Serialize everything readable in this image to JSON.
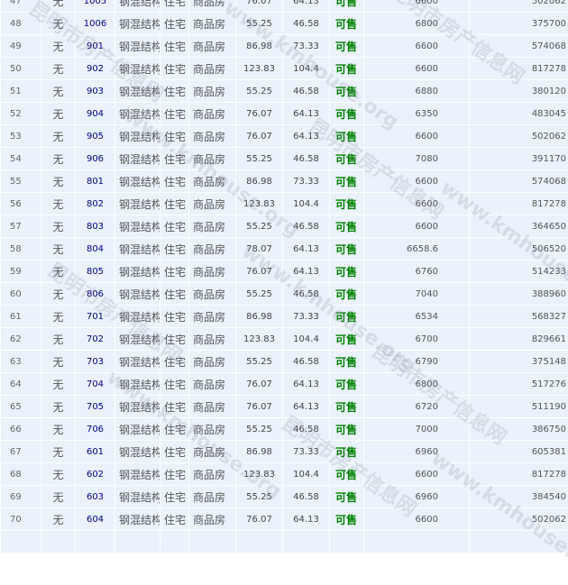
{
  "rows": [
    {
      "idx": "47",
      "wu": "无",
      "room": "1005",
      "struct": "钢混结构",
      "use": "住宅",
      "type": "商品房",
      "area": "76.07",
      "inner": "64.13",
      "status": "可售",
      "price": "6600",
      "total": "502062"
    },
    {
      "idx": "48",
      "wu": "无",
      "room": "1006",
      "struct": "钢混结构",
      "use": "住宅",
      "type": "商品房",
      "area": "55.25",
      "inner": "46.58",
      "status": "可售",
      "price": "6800",
      "total": "375700"
    },
    {
      "idx": "49",
      "wu": "无",
      "room": "901",
      "struct": "钢混结构",
      "use": "住宅",
      "type": "商品房",
      "area": "86.98",
      "inner": "73.33",
      "status": "可售",
      "price": "6600",
      "total": "574068"
    },
    {
      "idx": "50",
      "wu": "无",
      "room": "902",
      "struct": "钢混结构",
      "use": "住宅",
      "type": "商品房",
      "area": "123.83",
      "inner": "104.4",
      "status": "可售",
      "price": "6600",
      "total": "817278"
    },
    {
      "idx": "51",
      "wu": "无",
      "room": "903",
      "struct": "钢混结构",
      "use": "住宅",
      "type": "商品房",
      "area": "55.25",
      "inner": "46.58",
      "status": "可售",
      "price": "6880",
      "total": "380120"
    },
    {
      "idx": "52",
      "wu": "无",
      "room": "904",
      "struct": "钢混结构",
      "use": "住宅",
      "type": "商品房",
      "area": "76.07",
      "inner": "64.13",
      "status": "可售",
      "price": "6350",
      "total": "483045"
    },
    {
      "idx": "53",
      "wu": "无",
      "room": "905",
      "struct": "钢混结构",
      "use": "住宅",
      "type": "商品房",
      "area": "76.07",
      "inner": "64.13",
      "status": "可售",
      "price": "6600",
      "total": "502062"
    },
    {
      "idx": "54",
      "wu": "无",
      "room": "906",
      "struct": "钢混结构",
      "use": "住宅",
      "type": "商品房",
      "area": "55.25",
      "inner": "46.58",
      "status": "可售",
      "price": "7080",
      "total": "391170"
    },
    {
      "idx": "55",
      "wu": "无",
      "room": "801",
      "struct": "钢混结构",
      "use": "住宅",
      "type": "商品房",
      "area": "86.98",
      "inner": "73.33",
      "status": "可售",
      "price": "6600",
      "total": "574068"
    },
    {
      "idx": "56",
      "wu": "无",
      "room": "802",
      "struct": "钢混结构",
      "use": "住宅",
      "type": "商品房",
      "area": "123.83",
      "inner": "104.4",
      "status": "可售",
      "price": "6600",
      "total": "817278"
    },
    {
      "idx": "57",
      "wu": "无",
      "room": "803",
      "struct": "钢混结构",
      "use": "住宅",
      "type": "商品房",
      "area": "55.25",
      "inner": "46.58",
      "status": "可售",
      "price": "6600",
      "total": "364650"
    },
    {
      "idx": "58",
      "wu": "无",
      "room": "804",
      "struct": "钢混结构",
      "use": "住宅",
      "type": "商品房",
      "area": "78.07",
      "inner": "64.13",
      "status": "可售",
      "price": "6658.6",
      "total": "506520"
    },
    {
      "idx": "59",
      "wu": "无",
      "room": "805",
      "struct": "钢混结构",
      "use": "住宅",
      "type": "商品房",
      "area": "76.07",
      "inner": "64.13",
      "status": "可售",
      "price": "6760",
      "total": "514233"
    },
    {
      "idx": "60",
      "wu": "无",
      "room": "806",
      "struct": "钢混结构",
      "use": "住宅",
      "type": "商品房",
      "area": "55.25",
      "inner": "46.58",
      "status": "可售",
      "price": "7040",
      "total": "388960"
    },
    {
      "idx": "61",
      "wu": "无",
      "room": "701",
      "struct": "钢混结构",
      "use": "住宅",
      "type": "商品房",
      "area": "86.98",
      "inner": "73.33",
      "status": "可售",
      "price": "6534",
      "total": "568327"
    },
    {
      "idx": "62",
      "wu": "无",
      "room": "702",
      "struct": "钢混结构",
      "use": "住宅",
      "type": "商品房",
      "area": "123.83",
      "inner": "104.4",
      "status": "可售",
      "price": "6700",
      "total": "829661"
    },
    {
      "idx": "63",
      "wu": "无",
      "room": "703",
      "struct": "钢混结构",
      "use": "住宅",
      "type": "商品房",
      "area": "55.25",
      "inner": "46.58",
      "status": "可售",
      "price": "6790",
      "total": "375148"
    },
    {
      "idx": "64",
      "wu": "无",
      "room": "704",
      "struct": "钢混结构",
      "use": "住宅",
      "type": "商品房",
      "area": "76.07",
      "inner": "64.13",
      "status": "可售",
      "price": "6800",
      "total": "517276"
    },
    {
      "idx": "65",
      "wu": "无",
      "room": "705",
      "struct": "钢混结构",
      "use": "住宅",
      "type": "商品房",
      "area": "76.07",
      "inner": "64.13",
      "status": "可售",
      "price": "6720",
      "total": "511190"
    },
    {
      "idx": "66",
      "wu": "无",
      "room": "706",
      "struct": "钢混结构",
      "use": "住宅",
      "type": "商品房",
      "area": "55.25",
      "inner": "46.58",
      "status": "可售",
      "price": "7000",
      "total": "386750"
    },
    {
      "idx": "67",
      "wu": "无",
      "room": "601",
      "struct": "钢混结构",
      "use": "住宅",
      "type": "商品房",
      "area": "86.98",
      "inner": "73.33",
      "status": "可售",
      "price": "6960",
      "total": "605381"
    },
    {
      "idx": "68",
      "wu": "无",
      "room": "602",
      "struct": "钢混结构",
      "use": "住宅",
      "type": "商品房",
      "area": "123.83",
      "inner": "104.4",
      "status": "可售",
      "price": "6600",
      "total": "817278"
    },
    {
      "idx": "69",
      "wu": "无",
      "room": "603",
      "struct": "钢混结构",
      "use": "住宅",
      "type": "商品房",
      "area": "55.25",
      "inner": "46.58",
      "status": "可售",
      "price": "6960",
      "total": "384540"
    },
    {
      "idx": "70",
      "wu": "无",
      "room": "604",
      "struct": "钢混结构",
      "use": "住宅",
      "type": "商品房",
      "area": "76.07",
      "inner": "64.13",
      "status": "可售",
      "price": "6600",
      "total": "502062"
    },
    {
      "idx": "",
      "wu": "",
      "room": "",
      "struct": "",
      "use": "",
      "type": "",
      "area": "",
      "inner": "",
      "status": "",
      "price": "",
      "total": ""
    }
  ],
  "watermark": {
    "cn": "昆明市房产信息网",
    "url": "www.kmhouse.org"
  },
  "colors": {
    "cell_bg": "#eaf2fb",
    "status": "#008000",
    "room_link": "#000080"
  }
}
